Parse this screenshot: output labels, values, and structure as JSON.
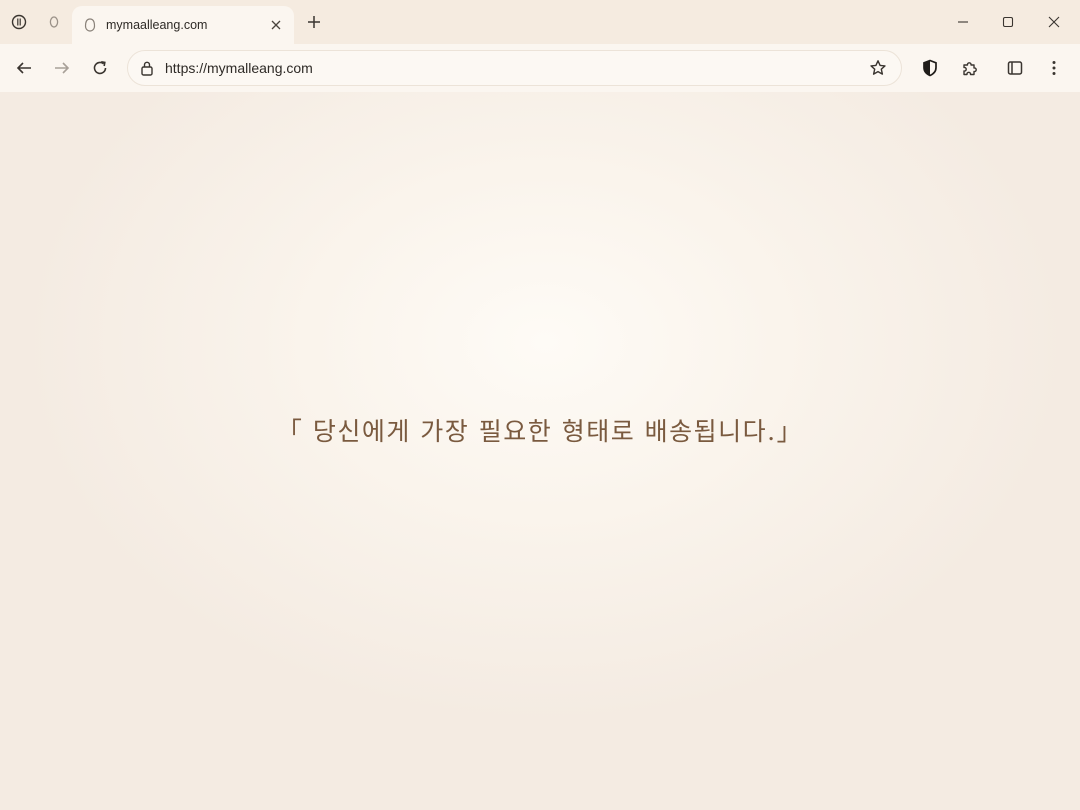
{
  "browser": {
    "tab": {
      "title": "mymaalleang.com"
    },
    "toolbar": {
      "url": "https://mymalleang.com"
    },
    "icons": {
      "tab_search": "tab-search-icon",
      "loading_tab": "loading-tab-icon",
      "favicon": "default-favicon-icon",
      "close": "close-icon",
      "new_tab": "plus-icon",
      "minimize": "minimize-icon",
      "maximize": "maximize-icon",
      "window_close": "window-close-icon",
      "back": "back-arrow-icon",
      "forward": "forward-arrow-icon",
      "reload": "reload-icon",
      "lock": "lock-icon",
      "bookmark": "star-icon",
      "shield": "shield-icon",
      "extensions": "puzzle-icon",
      "split": "split-view-icon",
      "menu": "kebab-menu-icon"
    }
  },
  "page": {
    "tagline": "「 당신에게 가장 필요한 형태로 배송됩니다.」"
  },
  "colors": {
    "tab_strip": "#f5ebe0",
    "toolbar": "#fbf6f0",
    "page_background": "#f6efe7",
    "tagline_text": "#7a5a3f"
  }
}
